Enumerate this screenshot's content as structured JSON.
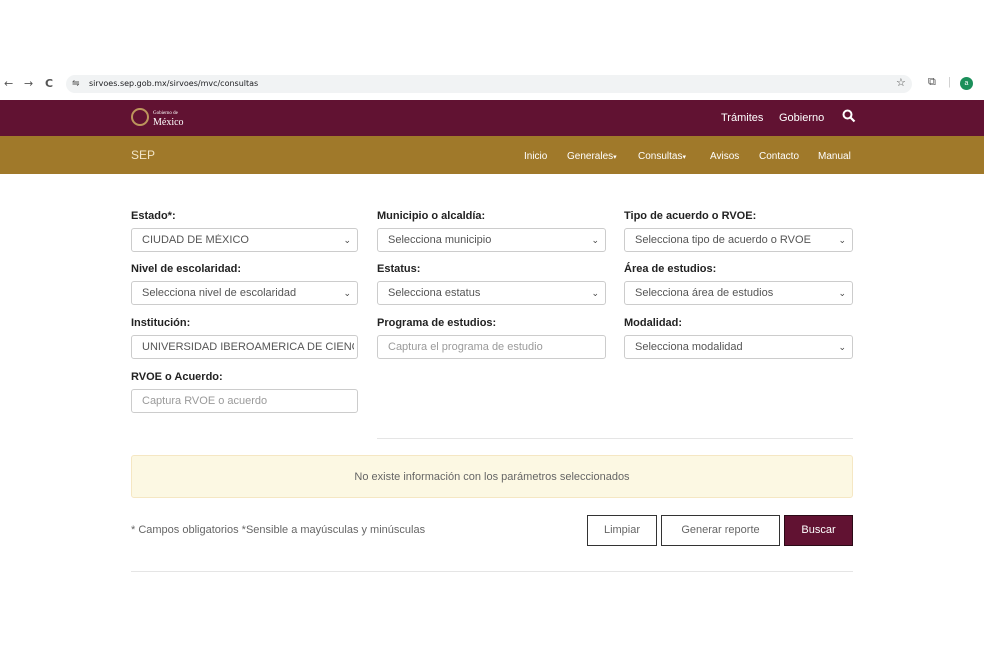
{
  "browser": {
    "back": "←",
    "forward": "→",
    "reload": "C",
    "site_info": "⇋",
    "url": "sirvoes.sep.gob.mx/sirvoes/mvc/consultas",
    "star": "☆",
    "extensions": "⧉",
    "profile_initial": "a"
  },
  "gov": {
    "logo_small": "Gobierno de",
    "logo_main": "México",
    "links": [
      "Trámites",
      "Gobierno"
    ]
  },
  "sep": {
    "brand": "SEP",
    "nav": [
      {
        "label": "Inicio",
        "dropdown": false
      },
      {
        "label": "Generales",
        "dropdown": true
      },
      {
        "label": "Consultas",
        "dropdown": true
      },
      {
        "label": "Avisos",
        "dropdown": false
      },
      {
        "label": "Contacto",
        "dropdown": false
      },
      {
        "label": "Manual",
        "dropdown": false
      }
    ]
  },
  "form": {
    "estado": {
      "label": "Estado*:",
      "value": "CIUDAD DE MÉXICO"
    },
    "municipio": {
      "label": "Municipio o alcaldía:",
      "placeholder": "Selecciona municipio"
    },
    "tipo": {
      "label": "Tipo de acuerdo o RVOE:",
      "placeholder": "Selecciona tipo de acuerdo o RVOE"
    },
    "nivel": {
      "label": "Nivel de escolaridad:",
      "placeholder": "Selecciona nivel de escolaridad"
    },
    "estatus": {
      "label": "Estatus:",
      "placeholder": "Selecciona estatus"
    },
    "area": {
      "label": "Área de estudios:",
      "placeholder": "Selecciona área de estudios"
    },
    "institucion": {
      "label": "Institución:",
      "value": "UNIVERSIDAD IBEROAMERICA DE CIENCI"
    },
    "programa": {
      "label": "Programa de estudios:",
      "placeholder": "Captura el programa de estudio"
    },
    "modalidad": {
      "label": "Modalidad:",
      "placeholder": "Selecciona modalidad"
    },
    "rvoe": {
      "label": "RVOE o Acuerdo:",
      "placeholder": "Captura RVOE o acuerdo"
    }
  },
  "alert_text": "No existe información con los parámetros seleccionados",
  "note": "* Campos obligatorios *Sensible a mayúsculas y minúsculas",
  "buttons": {
    "clear": "Limpiar",
    "report": "Generar reporte",
    "search": "Buscar"
  },
  "colors": {
    "gov_bar": "#611232",
    "sep_bar": "#a0792a",
    "alert_bg": "#fcf8e3",
    "primary": "#611232"
  }
}
